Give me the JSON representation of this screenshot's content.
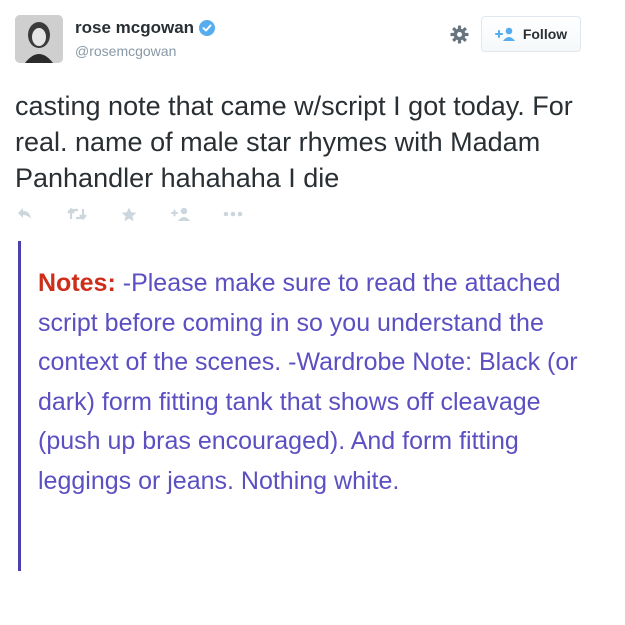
{
  "user": {
    "display_name": "rose mcgowan",
    "handle": "@rosemcgowan",
    "verified": true,
    "avatar_icon": "profile-photo"
  },
  "header": {
    "settings_icon": "gear-icon",
    "follow_label": "Follow",
    "follow_icon": "add-user-icon"
  },
  "tweet": {
    "text": "casting note that came w/script I got today. For real. name of male star rhymes with Madam Panhandler hahahaha I die"
  },
  "actions": [
    {
      "name": "reply",
      "icon": "reply-icon"
    },
    {
      "name": "retweet",
      "icon": "retweet-icon"
    },
    {
      "name": "favorite",
      "icon": "star-icon"
    },
    {
      "name": "follow",
      "icon": "add-user-icon"
    },
    {
      "name": "more",
      "icon": "more-icon"
    }
  ],
  "attachment": {
    "notes_label": "Notes:",
    "notes_text": " -Please make sure to read the attached script before coming in so you understand the context of the scenes. -Wardrobe Note: Black (or dark) form fitting tank that shows off cleavage (push up bras encouraged). And form fitting leggings or jeans. Nothing white."
  },
  "colors": {
    "verified_blue": "#55acee",
    "notes_label_red": "#cc2e1a",
    "notes_text_purple": "#5b4fc2",
    "notes_bar": "#4d3fb0",
    "icon_gray": "#ccd6dd"
  }
}
